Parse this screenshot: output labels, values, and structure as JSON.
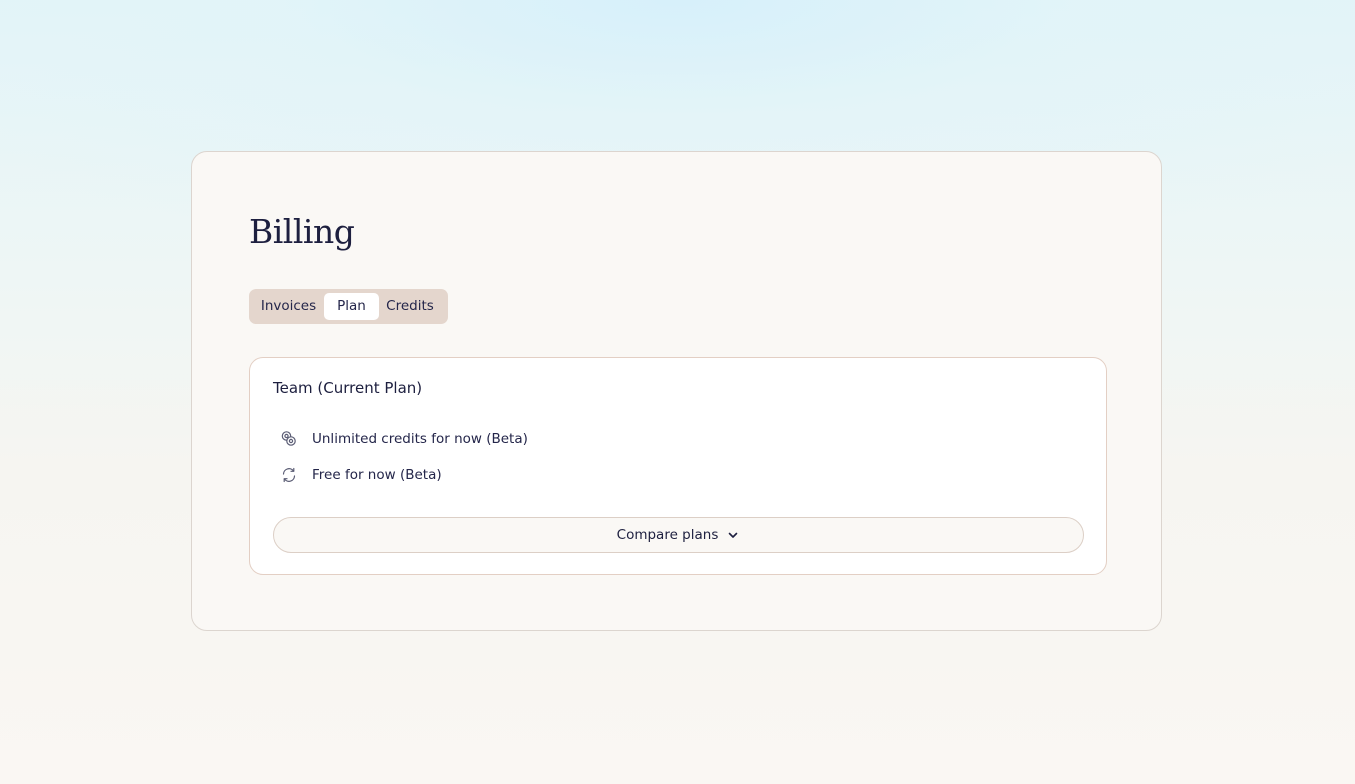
{
  "page": {
    "title": "Billing"
  },
  "tabs": [
    {
      "label": "Invoices",
      "selected": false
    },
    {
      "label": "Plan",
      "selected": true
    },
    {
      "label": "Credits",
      "selected": false
    }
  ],
  "plan": {
    "name": "Team (Current Plan)",
    "features": [
      {
        "icon": "coins-icon",
        "label": "Unlimited credits for now (Beta)"
      },
      {
        "icon": "refresh-icon",
        "label": "Free for now (Beta)"
      }
    ],
    "compare_label": "Compare plans"
  },
  "colors": {
    "text": "#1d1f3f",
    "tabs_bg": "#e4d6cd",
    "card_bg": "#faf8f5",
    "plan_border": "#e3cfc4"
  }
}
